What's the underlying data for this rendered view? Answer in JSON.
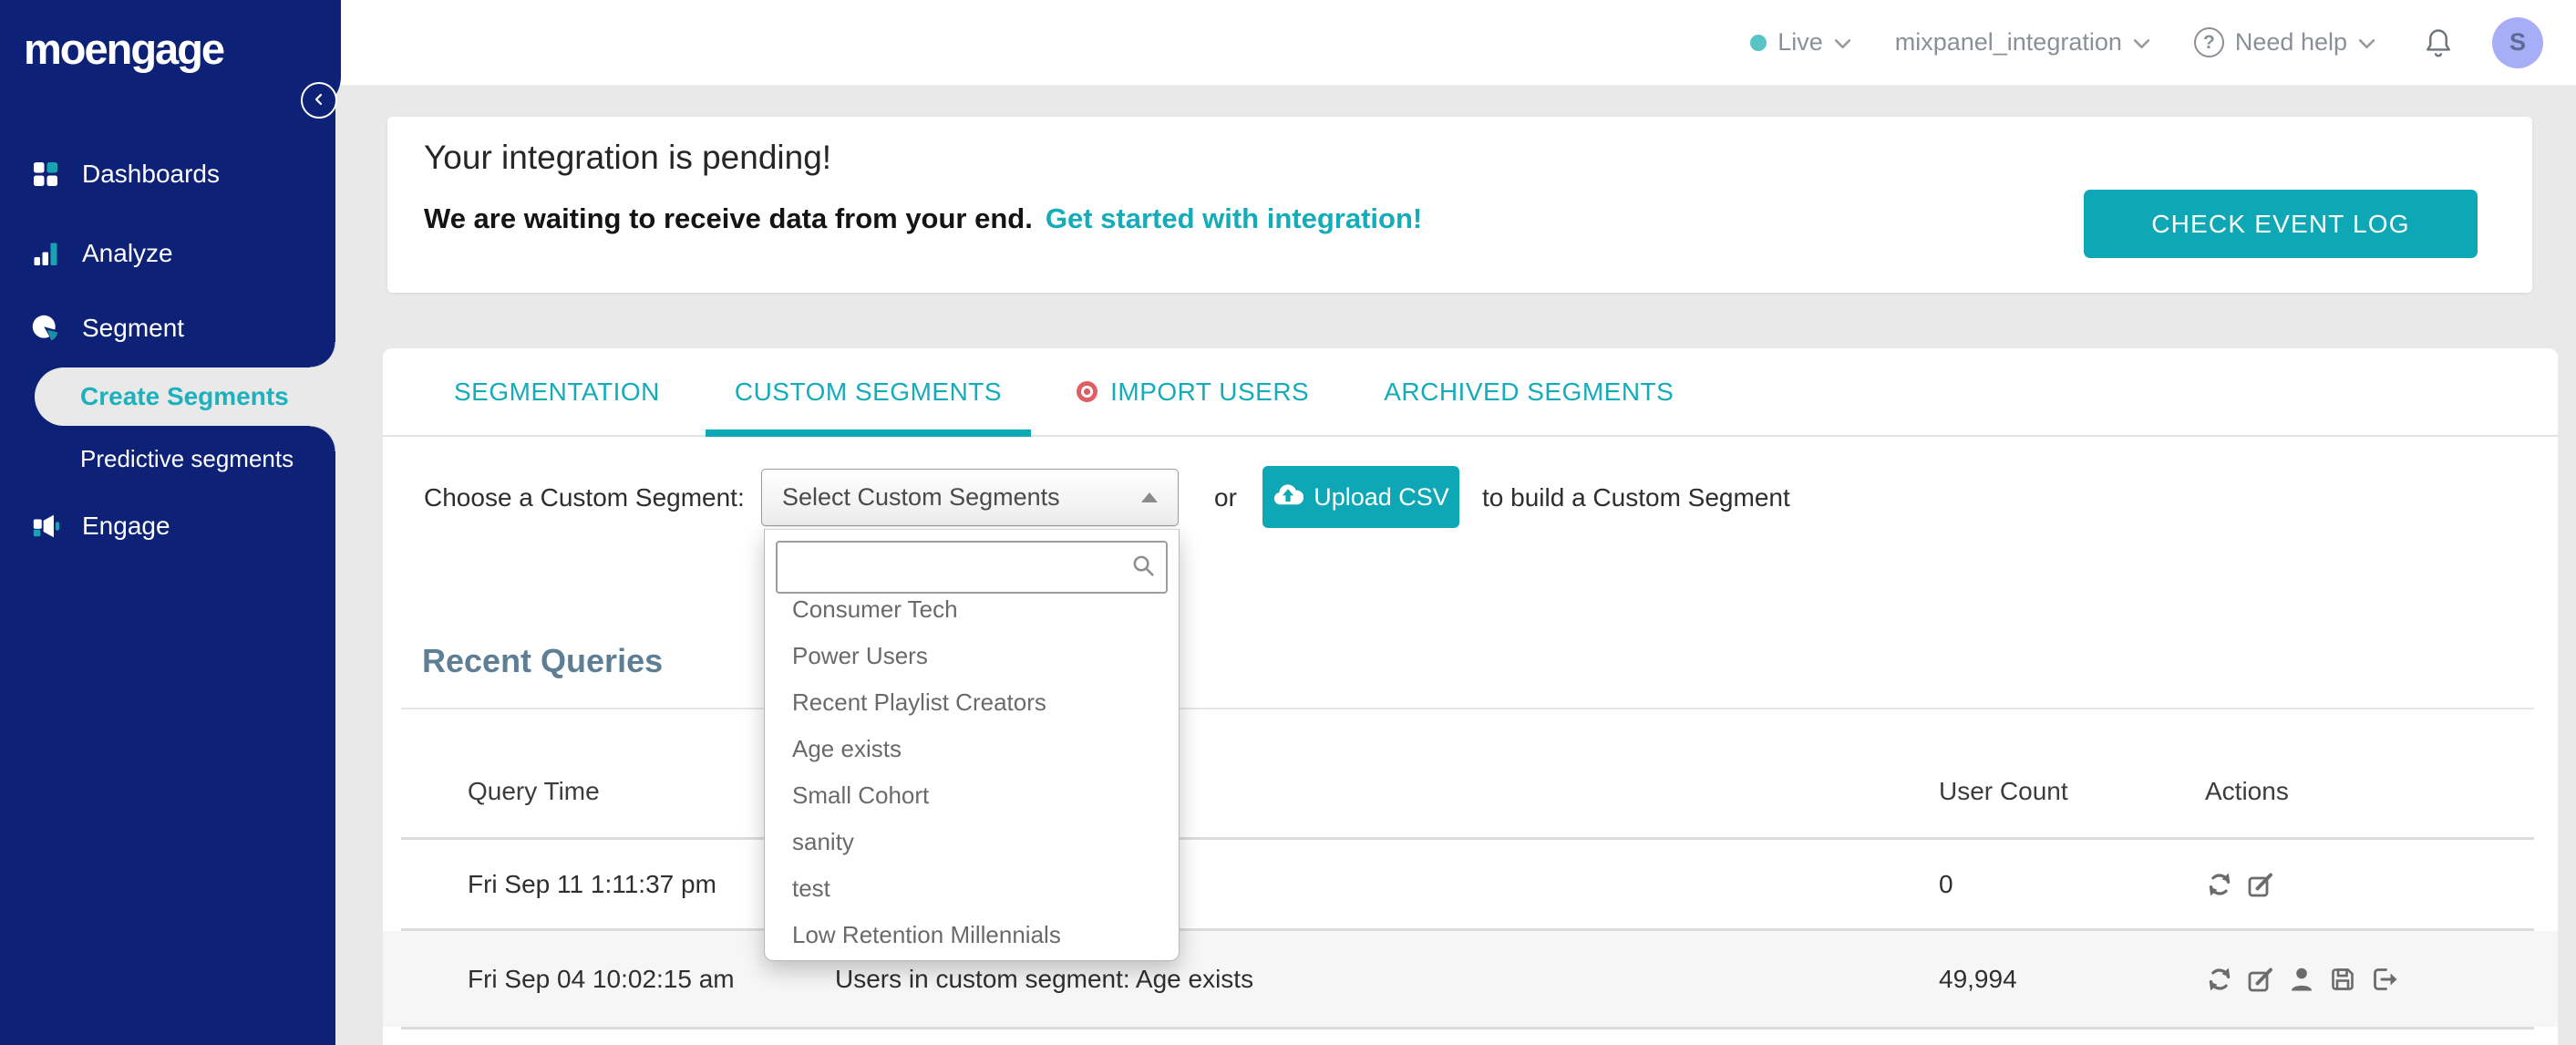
{
  "brand": {
    "logo_text": "moengage"
  },
  "topbar": {
    "environment": {
      "label": "Live",
      "dot_icon": "status-dot-icon",
      "chevron_icon": "chevron-down-icon"
    },
    "project": {
      "label": "mixpanel_integration",
      "chevron_icon": "chevron-down-icon"
    },
    "help": {
      "label": "Need help",
      "q_glyph": "?",
      "icon": "question-circle-icon",
      "chevron_icon": "chevron-down-icon"
    },
    "notifications": {
      "icon": "bell-icon"
    },
    "avatar": {
      "initial": "S"
    }
  },
  "sidebar": {
    "collapse_icon": "chevron-left-icon",
    "items": [
      {
        "label": "Dashboards",
        "icon": "dashboards-grid-icon"
      },
      {
        "label": "Analyze",
        "icon": "bar-chart-icon"
      },
      {
        "label": "Segment",
        "icon": "pie-chart-icon"
      },
      {
        "label": "Create Segments",
        "active": true
      },
      {
        "label": "Predictive segments"
      },
      {
        "label": "Engage",
        "icon": "megaphone-icon"
      }
    ]
  },
  "banner": {
    "title": "Your integration is pending!",
    "message": "We are waiting to receive data from your end.",
    "link_label": "Get started with integration!",
    "button_label": "CHECK EVENT LOG"
  },
  "tabs": [
    {
      "label": "SEGMENTATION",
      "active": false
    },
    {
      "label": "CUSTOM SEGMENTS",
      "active": true
    },
    {
      "label": "IMPORT USERS",
      "active": false,
      "badge_icon": "red-dot-icon"
    },
    {
      "label": "ARCHIVED SEGMENTS",
      "active": false
    }
  ],
  "chooser": {
    "label": "Choose a Custom Segment:",
    "select_value": "Select Custom Segments",
    "search_value": "",
    "search_icon": "magnifier-icon",
    "or_text": "or",
    "upload_button": "Upload CSV",
    "upload_icon": "cloud-upload-icon",
    "suffix_text": "to build a Custom Segment",
    "options": [
      "Consumer Tech",
      "Power Users",
      "Recent Playlist Creators",
      "Age exists",
      "Small Cohort",
      "sanity",
      "test",
      "Low Retention Millennials"
    ]
  },
  "recent_queries": {
    "title": "Recent Queries",
    "columns": {
      "time": "Query Time",
      "count": "User Count",
      "actions": "Actions"
    },
    "rows": [
      {
        "time": "Fri Sep 11 1:11:37 pm",
        "query": "",
        "count": "0",
        "actions": [
          "refresh-icon",
          "edit-icon"
        ]
      },
      {
        "time": "Fri Sep 04 10:02:15 am",
        "query": "Users in custom segment: Age exists",
        "count": "49,994",
        "actions": [
          "refresh-icon",
          "edit-icon",
          "user-icon",
          "save-icon",
          "export-icon"
        ]
      }
    ]
  },
  "colors": {
    "sidebar_navy": "#0d2277",
    "accent_teal": "#0ea7b5",
    "teal_text": "#15acba",
    "page_bg": "#e9e9e9",
    "heading_slate": "#5d7e94",
    "row_stripe": "#f6f6f6",
    "import_badge_red": "#e25c64",
    "avatar_bg": "#a7aef7",
    "live_dot": "#59c4c6"
  }
}
